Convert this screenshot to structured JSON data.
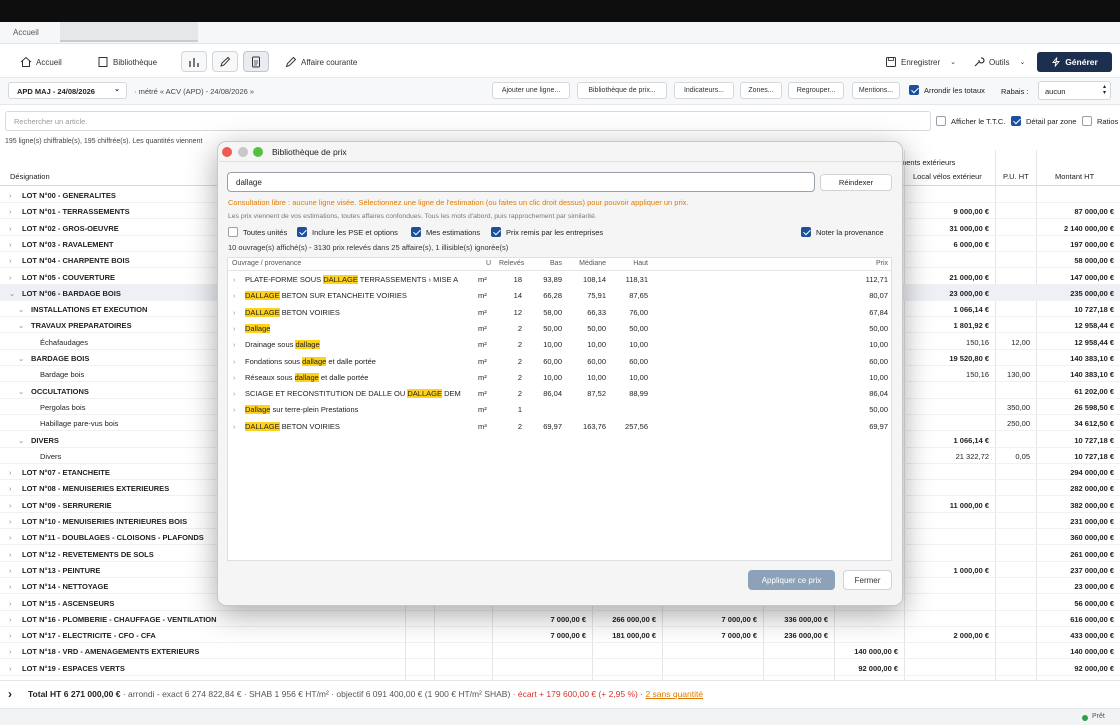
{
  "app": {
    "tab_home": "Accueil"
  },
  "toolbar": {
    "accueil": "Accueil",
    "bibliotheque": "Bibliothèque",
    "affaire": "Affaire courante",
    "enregistrer": "Enregistrer",
    "outils": "Outils",
    "generer": "Générer"
  },
  "filter": {
    "version": "APD MAJ - 24/08/2026",
    "compare": "· métré « ACV (APD) - 24/08/2026 »",
    "buttons": [
      "Ajouter une ligne...",
      "Bibliothèque de prix...",
      "Indicateurs...",
      "Zones...",
      "Regrouper...",
      "Mentions..."
    ],
    "arrondir": "Arrondir les totaux",
    "rabais_label": "Rabais :",
    "rabais_value": "aucun"
  },
  "search": {
    "placeholder": "Rechercher un article.",
    "afficher_ttc": "Afficher le T.T.C.",
    "detail_zone": "Détail par zone",
    "ratios": "Ratios"
  },
  "info_line": "195 ligne(s) chiffrable(s), 195 chiffrée(s). Les quantités viennent",
  "table": {
    "col_designation": "Désignation",
    "col_group": "ments extérieurs",
    "col_local": "Local vélos extérieur",
    "col_pu": "P.U. HT",
    "col_montant": "Montant HT",
    "rows": [
      {
        "label": "LOT N°00 - GENERALITES",
        "level": 0,
        "local": "",
        "pu": "",
        "montant": ""
      },
      {
        "label": "LOT N°01 - TERRASSEMENTS",
        "level": 0,
        "local": "9 000,00 €",
        "pu": "",
        "montant": "87 000,00 €"
      },
      {
        "label": "LOT N°02 - GROS-OEUVRE",
        "level": 0,
        "local": "31 000,00 €",
        "pu": "",
        "montant": "2 140 000,00 €"
      },
      {
        "label": "LOT N°03 - RAVALEMENT",
        "level": 0,
        "local": "6 000,00 €",
        "pu": "",
        "montant": "197 000,00 €"
      },
      {
        "label": "LOT N°04 - CHARPENTE BOIS",
        "level": 0,
        "local": "",
        "pu": "",
        "montant": "58 000,00 €"
      },
      {
        "label": "LOT N°05 - COUVERTURE",
        "level": 0,
        "local": "21 000,00 €",
        "pu": "",
        "montant": "147 000,00 €"
      },
      {
        "label": "LOT N°06 - BARDAGE BOIS",
        "level": 0,
        "local": "23 000,00 €",
        "pu": "",
        "montant": "235 000,00 €",
        "selected": true
      },
      {
        "label": "INSTALLATIONS ET EXECUTION",
        "level": 1,
        "local": "1 066,14 €",
        "pu": "",
        "montant": "10 727,18 €"
      },
      {
        "label": "TRAVAUX PREPARATOIRES",
        "level": 1,
        "local": "1 801,92 €",
        "pu": "",
        "montant": "12 958,44 €"
      },
      {
        "label": "Échafaudages",
        "level": 2,
        "local": "150,16",
        "pu": "12,00",
        "montant": "12 958,44 €"
      },
      {
        "label": "BARDAGE BOIS",
        "level": 1,
        "local": "19 520,80 €",
        "pu": "",
        "montant": "140 383,10 €"
      },
      {
        "label": "Bardage bois",
        "level": 2,
        "local": "150,16",
        "pu": "130,00",
        "montant": "140 383,10 €"
      },
      {
        "label": "OCCULTATIONS",
        "level": 1,
        "local": "",
        "pu": "",
        "montant": "61 202,00 €"
      },
      {
        "label": "Pergolas bois",
        "level": 2,
        "local": "",
        "pu": "350,00",
        "montant": "26 598,50 €"
      },
      {
        "label": "Habillage pare-vus bois",
        "level": 2,
        "local": "",
        "pu": "250,00",
        "montant": "34 612,50 €"
      },
      {
        "label": "DIVERS",
        "level": 1,
        "local": "1 066,14 €",
        "pu": "",
        "montant": "10 727,18 €"
      },
      {
        "label": "Divers",
        "level": 2,
        "local": "21 322,72",
        "pu": "0,05",
        "montant": "10 727,18 €"
      },
      {
        "label": "LOT N°07 - ETANCHEITE",
        "level": 0,
        "local": "",
        "pu": "",
        "montant": "294 000,00 €"
      },
      {
        "label": "LOT N°08 - MENUISERIES EXTERIEURES",
        "level": 0,
        "local": "",
        "pu": "",
        "montant": "282 000,00 €"
      },
      {
        "label": "LOT N°09 - SERRURERIE",
        "level": 0,
        "local": "11 000,00 €",
        "pu": "",
        "montant": "382 000,00 €"
      },
      {
        "label": "LOT N°10 - MENUISERIES INTERIEURES BOIS",
        "level": 0,
        "local": "",
        "pu": "",
        "montant": "231 000,00 €"
      },
      {
        "label": "LOT N°11 - DOUBLAGES - CLOISONS - PLAFONDS",
        "level": 0,
        "local": "",
        "pu": "",
        "montant": "360 000,00 €"
      },
      {
        "label": "LOT N°12 - REVETEMENTS DE SOLS",
        "level": 0,
        "local": "",
        "pu": "",
        "montant": "261 000,00 €"
      },
      {
        "label": "LOT N°13 - PEINTURE",
        "level": 0,
        "local": "1 000,00 €",
        "pu": "",
        "montant": "237 000,00 €"
      },
      {
        "label": "LOT N°14 - NETTOYAGE",
        "level": 0,
        "local": "",
        "pu": "",
        "montant": "23 000,00 €"
      },
      {
        "label": "LOT N°15 - ASCENSEURS",
        "level": 0,
        "local": "",
        "pu": "",
        "montant": "56 000,00 €"
      },
      {
        "label": "LOT N°16 - PLOMBERIE - CHAUFFAGE - VENTILATION",
        "level": 0,
        "c1": "7 000,00 €",
        "c2": "266 000,00 €",
        "c3": "7 000,00 €",
        "c4": "336 000,00 €",
        "c5": "",
        "local": "",
        "pu": "",
        "montant": "616 000,00 €"
      },
      {
        "label": "LOT N°17 - ELECTRICITE - CFO - CFA",
        "level": 0,
        "c1": "7 000,00 €",
        "c2": "181 000,00 €",
        "c3": "7 000,00 €",
        "c4": "236 000,00 €",
        "c5": "",
        "local": "2 000,00 €",
        "pu": "",
        "montant": "433 000,00 €"
      },
      {
        "label": "LOT N°18 - VRD - AMENAGEMENTS EXTERIEURS",
        "level": 0,
        "c1": "",
        "c2": "",
        "c3": "",
        "c4": "",
        "c5": "140 000,00 €",
        "local": "",
        "pu": "",
        "montant": "140 000,00 €"
      },
      {
        "label": "LOT N°19 - ESPACES VERTS",
        "level": 0,
        "c1": "",
        "c2": "",
        "c3": "",
        "c4": "",
        "c5": "92 000,00 €",
        "local": "",
        "pu": "",
        "montant": "92 000,00 €"
      }
    ]
  },
  "footer": {
    "total_label": "Total HT",
    "total_value": "6 271 000,00 €",
    "details": "· arrondi - exact 6 274 822,84 € · SHAB 1 956 € HT/m² · objectif 6 091 400,00 € (1 900 € HT/m² SHAB)",
    "ecart": "· écart + 179 600,00 € (+ 2,95 %)",
    "sans_qte": "2 sans quantité",
    "sep": " · "
  },
  "status": {
    "text": "Prêt",
    "color": "#2e9e4f"
  },
  "modal": {
    "title": "Bibliothèque de prix",
    "search_value": "dallage",
    "reset": "Réindexer",
    "warning": "Consultation libre : aucune ligne visée. Sélectionnez une ligne de l'estimation (ou faites un clic droit dessus) pour pouvoir appliquer un prix.",
    "note": "Les prix viennent de vos estimations, toutes affaires confondues. Tous les mots d'abord, puis rapprochement par similarité.",
    "options": [
      {
        "label": "Toutes unités",
        "checked": false
      },
      {
        "label": "Inclure les PSE et options",
        "checked": true
      },
      {
        "label": "Mes estimations",
        "checked": true
      },
      {
        "label": "Prix remis par les entreprises",
        "checked": true
      }
    ],
    "noter": "Noter la provenance",
    "summary": "10 ouvrage(s) affiché(s) - 3130 prix relevés dans 25 affaire(s), 1 illisible(s) ignorée(s)",
    "headers": {
      "ouvrage": "Ouvrage / provenance",
      "u": "U",
      "releves": "Relevés",
      "bas": "Bas",
      "mediane": "Médiane",
      "haut": "Haut",
      "prix": "Prix"
    },
    "rows": [
      {
        "parts": [
          "PLATE-FORME SOUS ",
          "DALLAGE",
          " TERRASSEMENTS › MISE A"
        ],
        "u": "m²",
        "releves": "18",
        "bas": "93,89",
        "mediane": "108,14",
        "haut": "118,31",
        "prix": "112,71"
      },
      {
        "parts": [
          "",
          "DALLAGE",
          " BETON SUR ETANCHEITE VOIRIES"
        ],
        "u": "m²",
        "releves": "14",
        "bas": "66,28",
        "mediane": "75,91",
        "haut": "87,65",
        "prix": "80,07"
      },
      {
        "parts": [
          "",
          "DALLAGE",
          " BETON VOIRIES"
        ],
        "u": "m²",
        "releves": "12",
        "bas": "58,00",
        "mediane": "66,33",
        "haut": "76,00",
        "prix": "67,84"
      },
      {
        "parts": [
          "",
          "Dallage",
          ""
        ],
        "u": "m²",
        "releves": "2",
        "bas": "50,00",
        "mediane": "50,00",
        "haut": "50,00",
        "prix": "50,00"
      },
      {
        "parts": [
          "Drainage sous ",
          "dallage",
          ""
        ],
        "u": "m²",
        "releves": "2",
        "bas": "10,00",
        "mediane": "10,00",
        "haut": "10,00",
        "prix": "10,00"
      },
      {
        "parts": [
          "Fondations sous ",
          "dallage",
          " et dalle portée"
        ],
        "u": "m²",
        "releves": "2",
        "bas": "60,00",
        "mediane": "60,00",
        "haut": "60,00",
        "prix": "60,00"
      },
      {
        "parts": [
          "Réseaux sous ",
          "dallage",
          " et dalle portée"
        ],
        "u": "m²",
        "releves": "2",
        "bas": "10,00",
        "mediane": "10,00",
        "haut": "10,00",
        "prix": "10,00"
      },
      {
        "parts": [
          "SCIAGE ET RECONSTITUTION DE DALLE OU ",
          "DALLAGE",
          " DEM"
        ],
        "u": "m²",
        "releves": "2",
        "bas": "86,04",
        "mediane": "87,52",
        "haut": "88,99",
        "prix": "86,04"
      },
      {
        "parts": [
          "",
          "Dallage",
          " sur terre-plein Prestations"
        ],
        "u": "m²",
        "releves": "1",
        "bas": "",
        "mediane": "",
        "haut": "",
        "prix": "50,00"
      },
      {
        "parts": [
          "",
          "DALLAGE",
          " BETON VOIRIES"
        ],
        "u": "m³",
        "releves": "2",
        "bas": "69,97",
        "mediane": "163,76",
        "haut": "257,56",
        "prix": "69,97"
      }
    ],
    "apply": "Appliquer ce prix",
    "close": "Fermer"
  },
  "colors": {
    "accent": "#1d2f4f",
    "highlight": "#ffd21a",
    "warning": "#e07b00",
    "danger": "#d9342b"
  }
}
